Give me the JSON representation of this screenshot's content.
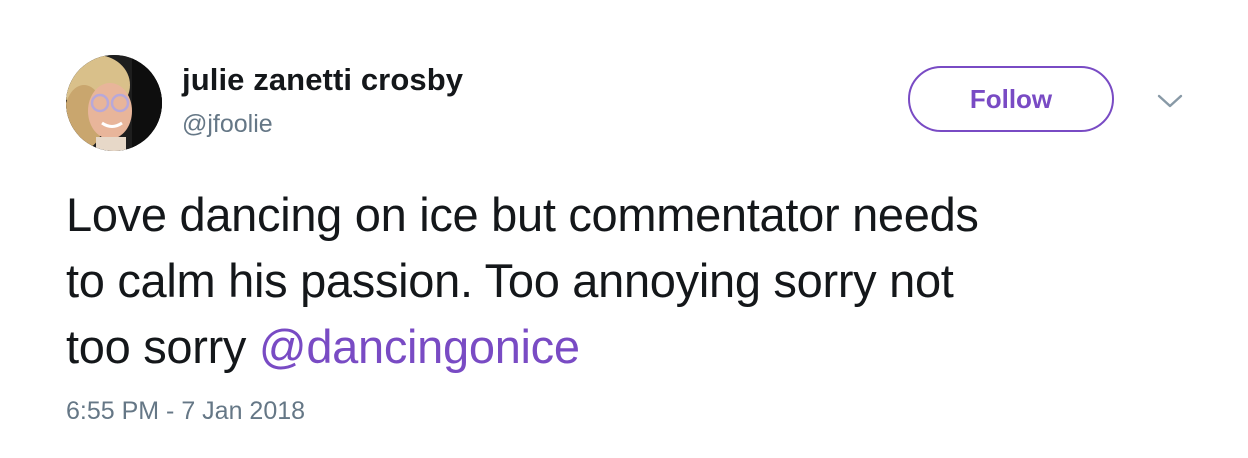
{
  "user": {
    "display_name": "julie zanetti crosby",
    "handle": "@jfoolie"
  },
  "follow_button": {
    "label": "Follow"
  },
  "tweet": {
    "text_line_1": "Love dancing on ice but commentator needs",
    "text_line_2": "to calm his passion. Too annoying sorry not",
    "text_line_3_prefix": "too sorry ",
    "mention": "@dancingonice",
    "timestamp": "6:55 PM - 7 Jan 2018"
  },
  "icons": {
    "more_menu": "chevron-down-icon"
  },
  "colors": {
    "accent": "#794bc4",
    "text_primary": "#14171a",
    "text_secondary": "#657786",
    "chevron": "#8899a6"
  }
}
